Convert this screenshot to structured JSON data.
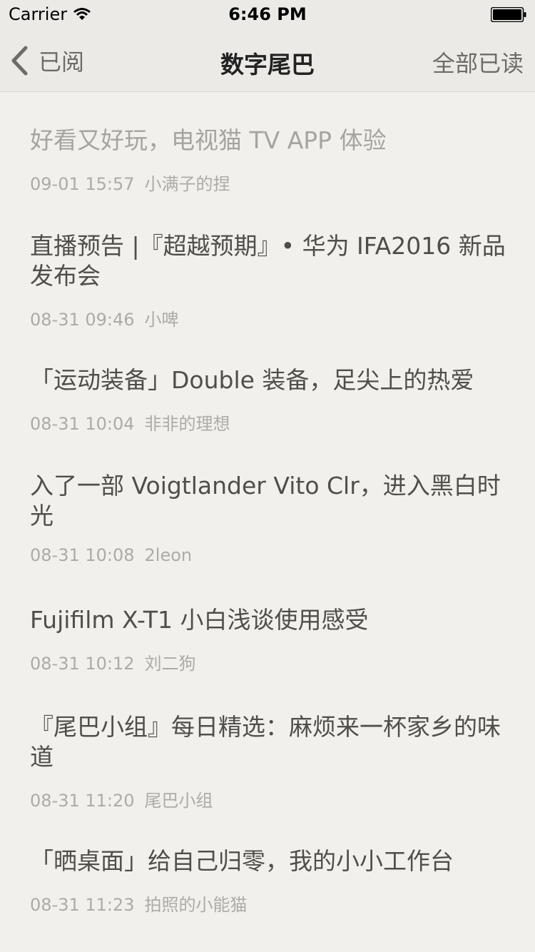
{
  "status": {
    "carrier": "Carrier",
    "time": "6:46 PM"
  },
  "nav": {
    "back_label": "已阅",
    "title": "数字尾巴",
    "right_label": "全部已读"
  },
  "articles": [
    {
      "title": "好看又好玩，电视猫 TV APP 体验",
      "date": "09-01 15:57",
      "author": "小满子的捏",
      "read": true
    },
    {
      "title": "直播预告 |『超越预期』• 华为 IFA2016 新品发布会",
      "date": "08-31 09:46",
      "author": "小啤",
      "read": false
    },
    {
      "title": "「运动装备」Double 装备，足尖上的热爱",
      "date": "08-31 10:04",
      "author": "非非的理想",
      "read": false
    },
    {
      "title": "入了一部 Voigtlander Vito Clr，进入黑白时光",
      "date": "08-31 10:08",
      "author": "2leon",
      "read": false
    },
    {
      "title": "Fujifilm X-T1 小白浅谈使用感受",
      "date": "08-31 10:12",
      "author": "刘二狗",
      "read": false
    },
    {
      "title": "『尾巴小组』每日精选：麻烦来一杯家乡的味道",
      "date": "08-31 11:20",
      "author": "尾巴小组",
      "read": false
    },
    {
      "title": "「晒桌面」给自己归零，我的小小工作台",
      "date": "08-31 11:23",
      "author": "拍照的小能猫",
      "read": false
    }
  ]
}
